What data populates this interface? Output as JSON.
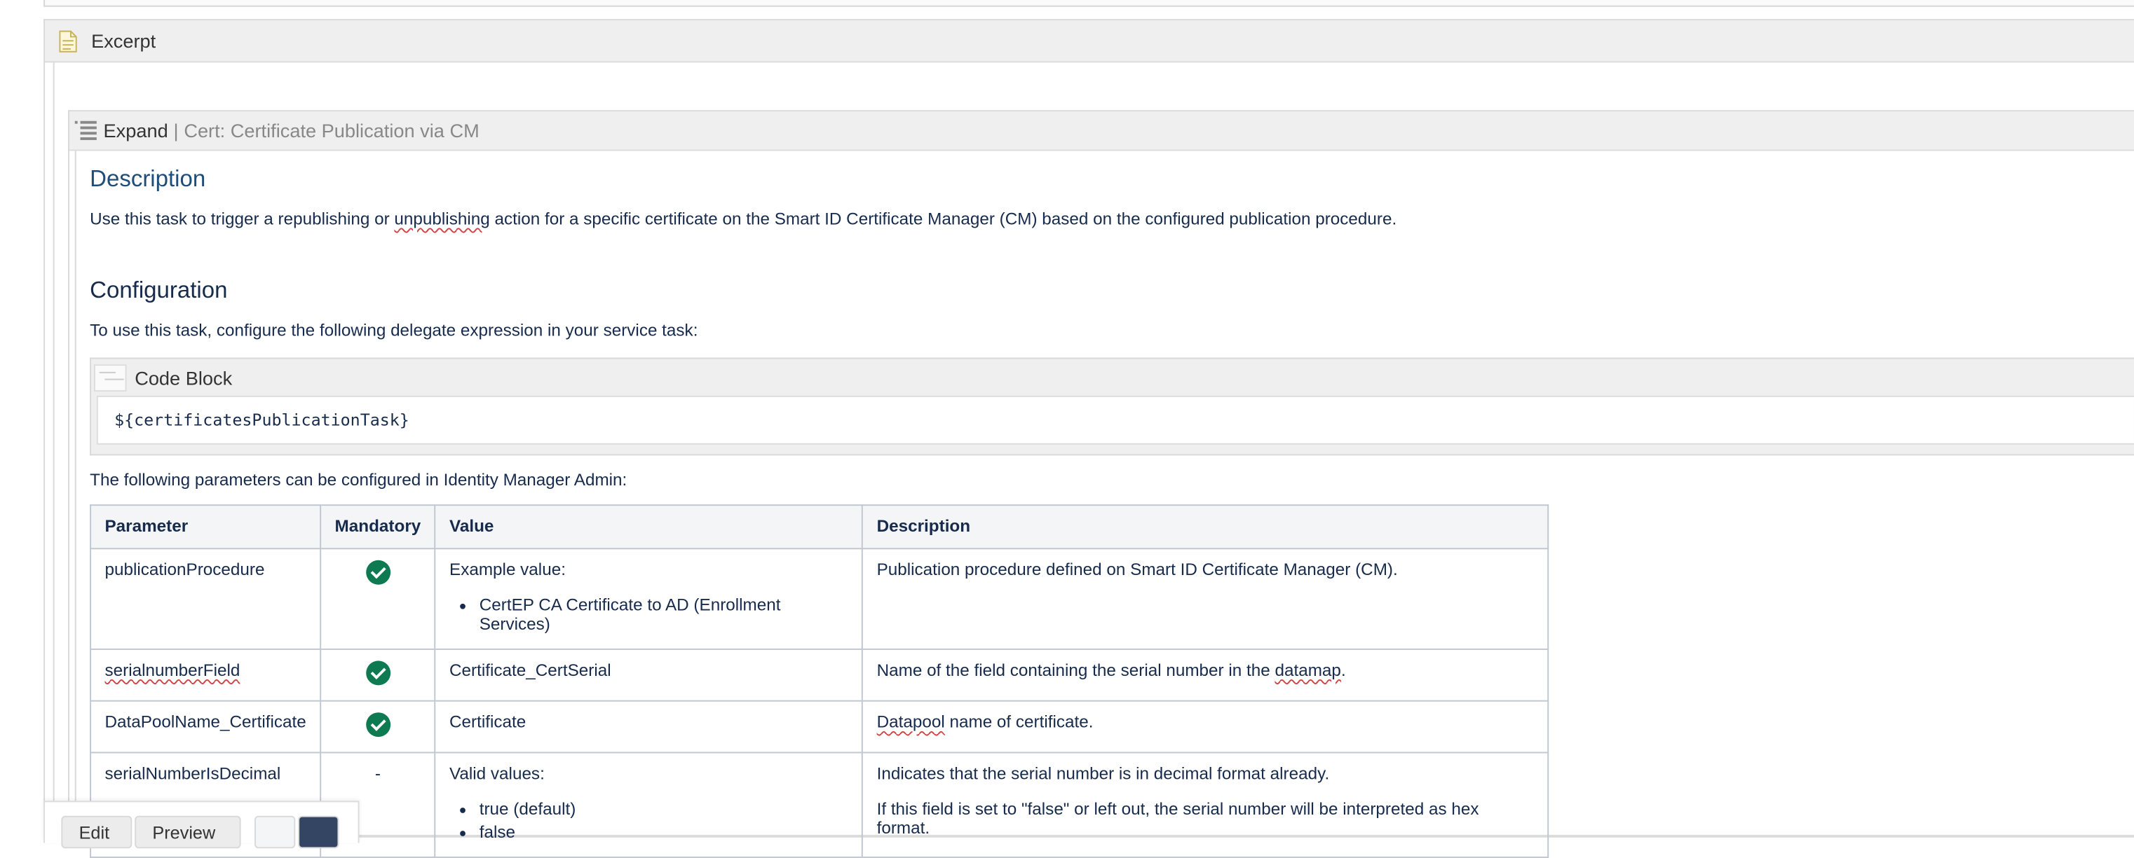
{
  "excerpt": {
    "title": "Excerpt"
  },
  "expand": {
    "label": "Expand",
    "separator": "|",
    "subtitle": "Cert: Certificate Publication via CM"
  },
  "description": {
    "heading": "Description",
    "text_before": "Use this task to trigger a republishing or ",
    "text_squiggle": "unpublishing",
    "text_after": " action for a specific certificate on the Smart ID Certificate Manager (CM) based on the configured publication procedure."
  },
  "configuration": {
    "heading": "Configuration",
    "intro": "To use this task, configure the following delegate expression in your service task:",
    "code_block_title": "Code Block",
    "code": "${certificatesPublicationTask}",
    "params_intro": "The following parameters can be configured in Identity Manager Admin:"
  },
  "table": {
    "headers": [
      "Parameter",
      "Mandatory",
      "Value",
      "Description"
    ],
    "rows": [
      {
        "parameter": "publicationProcedure",
        "mandatory": "check",
        "value": "Example value:",
        "value_items": [
          "CertEP CA Certificate to AD (Enrollment Services)"
        ],
        "description": "Publication procedure defined on Smart ID Certificate Manager (CM)."
      },
      {
        "parameter": "serialnumberField",
        "mandatory": "check",
        "value": "Certificate_CertSerial",
        "description_before": "Name of the field containing the serial number in the ",
        "description_squiggle": "datamap",
        "description_after": "."
      },
      {
        "parameter": "DataPoolName_Certificate",
        "mandatory": "check",
        "value": "Certificate",
        "description_squiggle": "Datapool",
        "description_after": " name of certificate."
      },
      {
        "parameter": "serialNumberIsDecimal",
        "mandatory": "-",
        "value": "Valid values:",
        "value_items": [
          "true (default)",
          "false"
        ],
        "description": "Indicates that the serial number is in decimal format already.",
        "description_2": "If this field is set to \"false\" or left out, the serial number will be interpreted as hex format."
      }
    ]
  },
  "bottom_bar": {
    "edit_label": "Edit",
    "preview_label": "Preview"
  },
  "colors": {
    "heading_blue": "#1f4d7a",
    "check_green": "#0e7a52",
    "header_gray": "#efefef"
  },
  "icons": [
    "page-icon",
    "list-icon",
    "code-icon",
    "check-icon"
  ]
}
